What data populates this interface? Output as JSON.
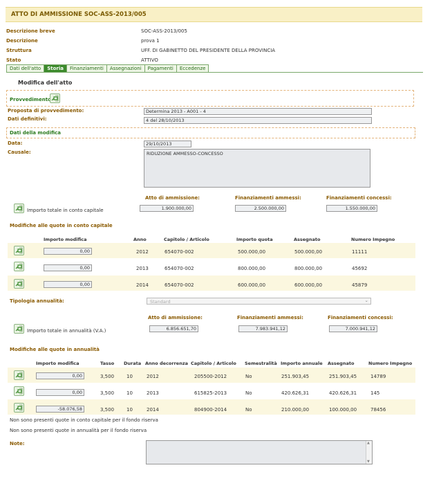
{
  "header": {
    "title": "ATTO DI AMMISSIONE SOC-ASS-2013/005"
  },
  "info": [
    {
      "label": "Descrizione breve",
      "value": "SOC-ASS-2013/005"
    },
    {
      "label": "Descrizione",
      "value": "prova 1"
    },
    {
      "label": "Struttura",
      "value": "UFF. DI GABINETTO DEL PRESIDENTE DELLA PROVINCIA"
    },
    {
      "label": "Stato",
      "value": "ATTIVO"
    }
  ],
  "tabs": [
    "Dati dell'atto",
    "Storia",
    "Finanziamenti",
    "Assegnazioni",
    "Pagamenti",
    "Eccedenze"
  ],
  "active_tab": "Storia",
  "section_title": "Modifica dell'atto",
  "provvedimento": {
    "label": "Provvedimento",
    "proposta_label": "Proposta di provvedimento:",
    "proposta_value": "Determina 2013 - A001 - 4",
    "definitivi_label": "Dati definitivi:",
    "definitivi_value": "4 del 28/10/2013"
  },
  "modifica": {
    "label": "Dati della modifica",
    "data_label": "Data:",
    "data_value": "29/10/2013",
    "causale_label": "Causale:",
    "causale_value": "RIDUZIONE AMMESSO-CONCESSO"
  },
  "capitale": {
    "totale_label": "Importo totale in conto capitale",
    "atto_label": "Atto di ammissione:",
    "atto_value": "1.900.000,00",
    "ammessi_label": "Finanziamenti ammessi:",
    "ammessi_value": "2.500.000,00",
    "concessi_label": "Finanziamenti concessi:",
    "concessi_value": "1.550.000,00",
    "quote_title": "Modifiche alle quote in conto capitale",
    "columns": [
      "Importo modifica",
      "Anno",
      "Capitolo / Articolo",
      "Importo quota",
      "Assegnato",
      "Numero Impegno"
    ],
    "rows": [
      {
        "importo": "0,00",
        "anno": "2012",
        "capitolo": "654070-002",
        "quota": "500.000,00",
        "assegnato": "500.000,00",
        "impegno": "11111"
      },
      {
        "importo": "0,00",
        "anno": "2013",
        "capitolo": "654070-002",
        "quota": "800.000,00",
        "assegnato": "800.000,00",
        "impegno": "45692"
      },
      {
        "importo": "0,00",
        "anno": "2014",
        "capitolo": "654070-002",
        "quota": "600.000,00",
        "assegnato": "600.000,00",
        "impegno": "45879"
      }
    ]
  },
  "annualita": {
    "tipologia_label": "Tipologia annualità:",
    "tipologia_value": "Standard",
    "totale_label": "Importo totale in annualità (V.A.)",
    "atto_label": "Atto di ammissione:",
    "atto_value": "6.856.651,70",
    "ammessi_label": "Finanziamenti ammessi:",
    "ammessi_value": "7.983.941,12",
    "concessi_label": "Finanziamenti concessi:",
    "concessi_value": "7.000.941,12",
    "quote_title": "Modifiche alle quote in annualità",
    "columns": [
      "Importo modifica",
      "Tasso",
      "Durata",
      "Anno decorrenza",
      "Capitolo / Articolo",
      "Semestralità",
      "Importo annuale",
      "Assegnato",
      "Numero Impegno"
    ],
    "rows": [
      {
        "importo": "0,00",
        "tasso": "3,500",
        "durata": "10",
        "anno": "2012",
        "capitolo": "205500-2012",
        "sem": "No",
        "annuale": "251.903,45",
        "assegnato": "251.903,45",
        "impegno": "14789"
      },
      {
        "importo": "0,00",
        "tasso": "3,500",
        "durata": "10",
        "anno": "2013",
        "capitolo": "615825-2013",
        "sem": "No",
        "annuale": "420.626,31",
        "assegnato": "420.626,31",
        "impegno": "145"
      },
      {
        "importo": "-58.076,58",
        "tasso": "3,500",
        "durata": "10",
        "anno": "2014",
        "capitolo": "804900-2014",
        "sem": "No",
        "annuale": "210.000,00",
        "assegnato": "100.000,00",
        "impegno": "78456"
      }
    ]
  },
  "footer": {
    "msg1": "Non sono presenti quote in conto capitale per il fondo riserva",
    "msg2": "Non sono presenti quote in annualità per il fondo riserva",
    "note_label": "Note:",
    "note_value": ""
  },
  "icons": {
    "edit": "edit-arrow-icon"
  },
  "colors": {
    "header_bg": "#f9f0c6",
    "label": "#8a5a00",
    "green": "#2b7a1e",
    "tab_active": "#3c8a2c",
    "row_bg": "#fbf7df"
  }
}
